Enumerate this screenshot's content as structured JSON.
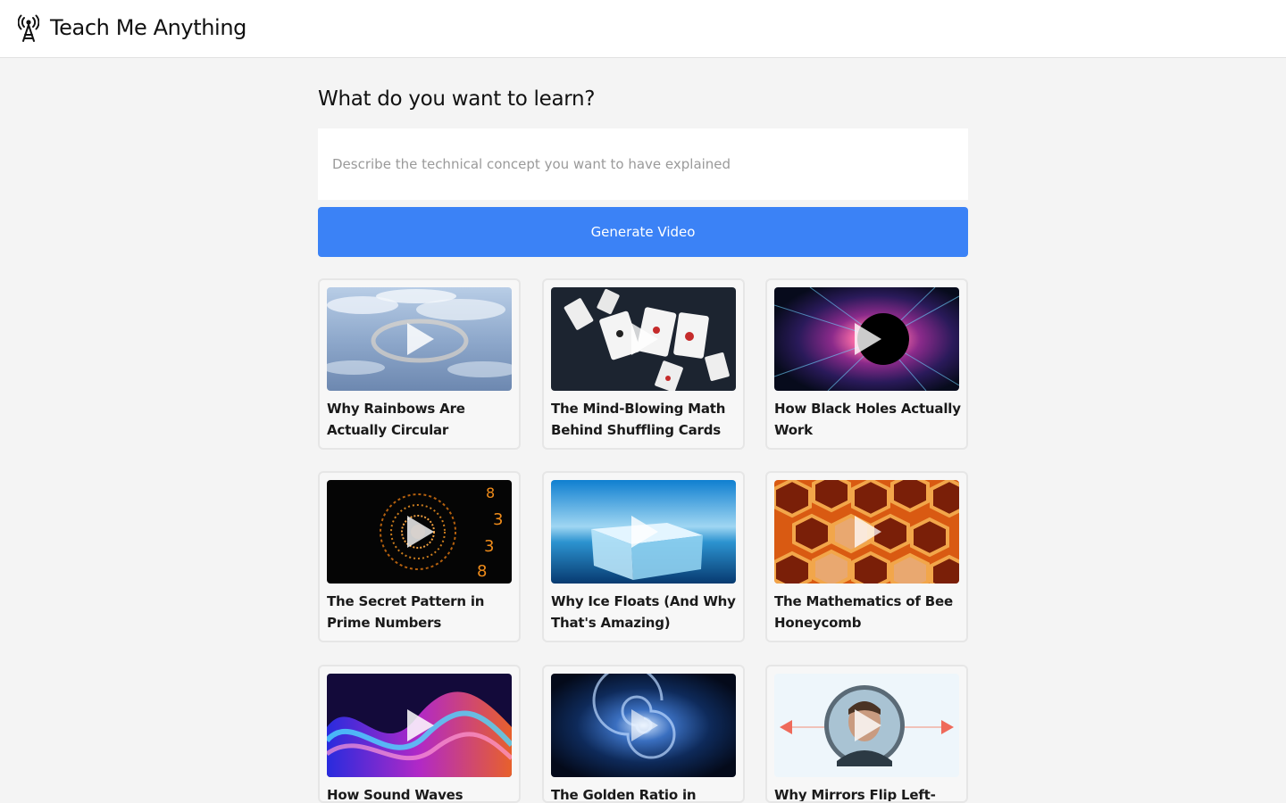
{
  "app": {
    "title": "Teach Me Anything"
  },
  "main": {
    "heading": "What do you want to learn?",
    "input_placeholder": "Describe the technical concept you want to have explained",
    "input_value": "",
    "generate_label": "Generate Video"
  },
  "colors": {
    "accent": "#3b82f6",
    "page_background": "#f4f4f4",
    "header_background": "#ffffff"
  },
  "icons": {
    "logo": "radio-tower-icon",
    "play": "play-icon"
  },
  "videos": [
    {
      "title": "Why Rainbows Are Actually Circular",
      "thumbnail": "clouds-halo"
    },
    {
      "title": "The Mind-Blowing Math Behind Shuffling Cards",
      "thumbnail": "flying-cards"
    },
    {
      "title": "How Black Holes Actually Work",
      "thumbnail": "black-hole"
    },
    {
      "title": "The Secret Pattern in Prime Numbers",
      "thumbnail": "number-spiral"
    },
    {
      "title": "Why Ice Floats (And Why That's Amazing)",
      "thumbnail": "ice-block"
    },
    {
      "title": "The Mathematics of Bee Honeycomb",
      "thumbnail": "honeycomb"
    },
    {
      "title": "How Sound Waves",
      "thumbnail": "sound-waves"
    },
    {
      "title": "The Golden Ratio in Nature",
      "thumbnail": "galaxy-spiral"
    },
    {
      "title": "Why Mirrors Flip Left-Right",
      "thumbnail": "mirror-portrait"
    }
  ]
}
